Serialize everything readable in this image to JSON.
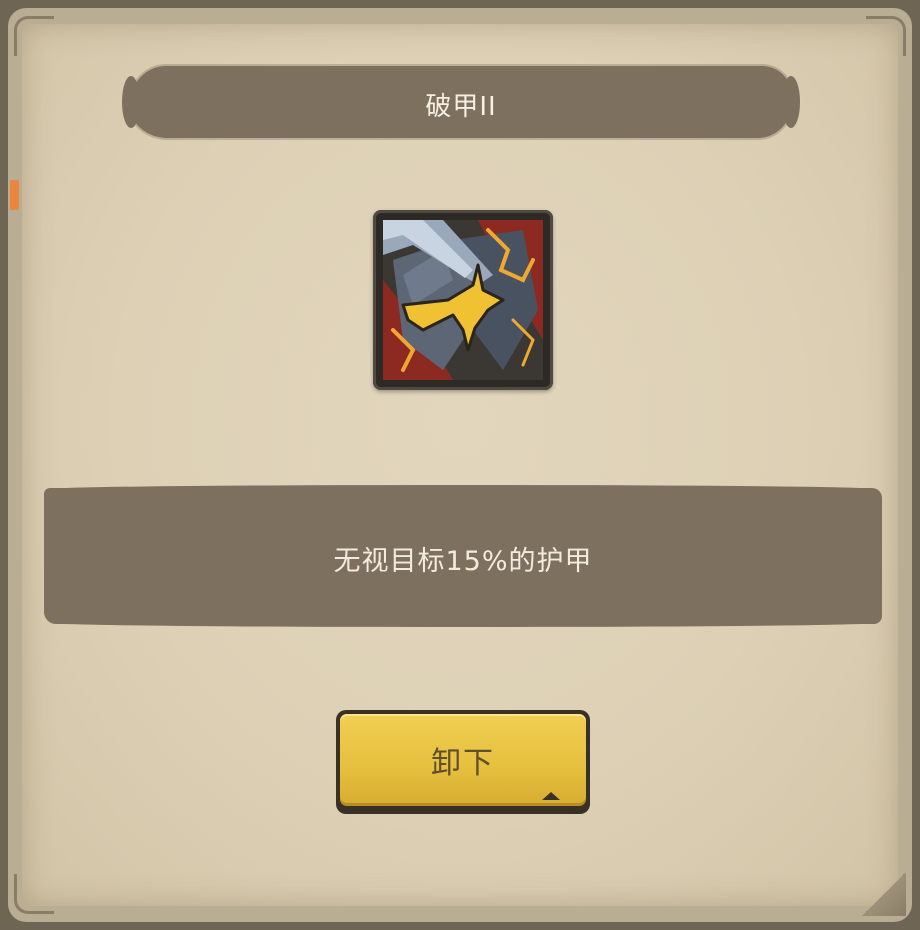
{
  "dialog": {
    "title": "破甲II",
    "skill_icon": "armor-break-icon",
    "description": "无视目标15%的护甲",
    "unequip_label": "卸下"
  },
  "colors": {
    "banner": "#7d705e",
    "parchment": "#ddd0b5",
    "frame": "#6f6554",
    "button": "#e6bf3e",
    "side_tab": "#e9873d"
  }
}
